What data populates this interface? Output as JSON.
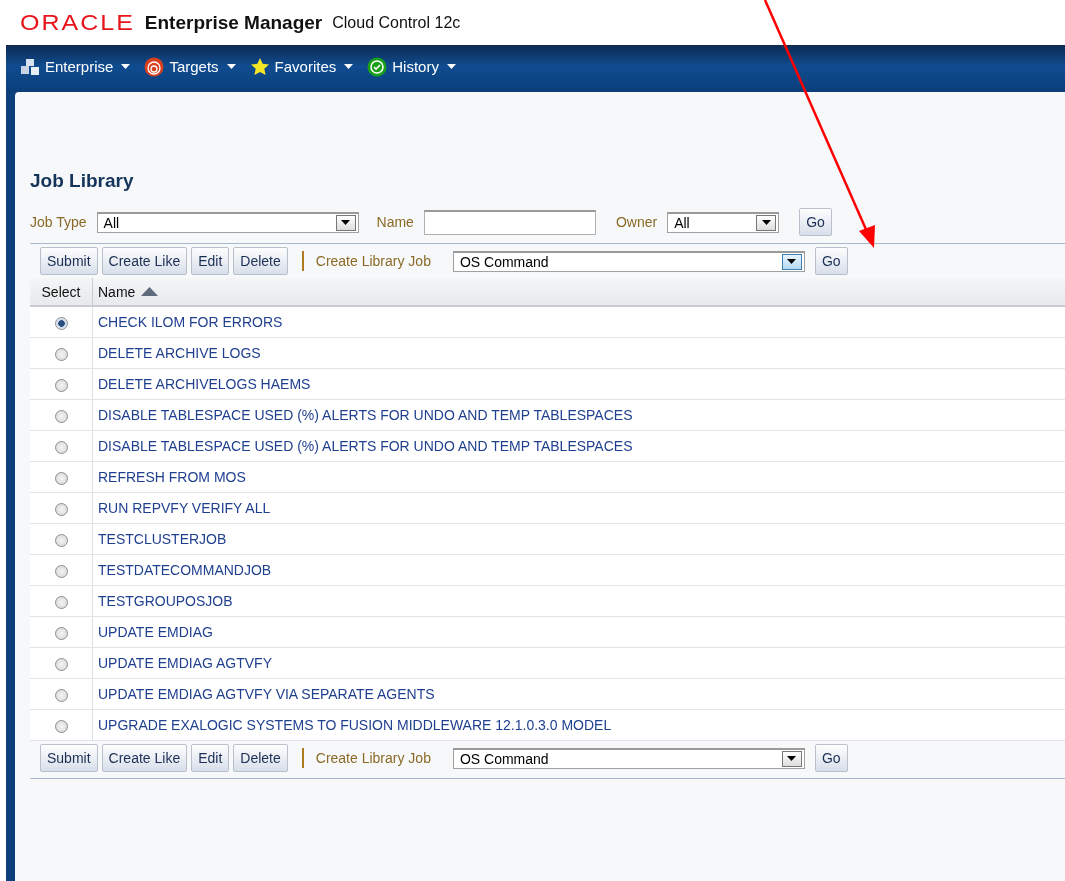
{
  "header": {
    "logo": "ORACLE",
    "product": "Enterprise Manager",
    "edition": "Cloud Control 12c"
  },
  "menu": [
    {
      "kind": "cubes",
      "label": "Enterprise"
    },
    {
      "kind": "target",
      "label": "Targets"
    },
    {
      "kind": "star",
      "label": "Favorites"
    },
    {
      "kind": "check",
      "label": "History"
    }
  ],
  "page_title": "Job Library",
  "filters": {
    "job_type": {
      "label": "Job Type",
      "value": "All"
    },
    "name": {
      "label": "Name"
    },
    "owner": {
      "label": "Owner",
      "value": "All"
    },
    "go": "Go"
  },
  "toolbar_top": {
    "buttons": [
      "Submit",
      "Create Like",
      "Edit",
      "Delete"
    ],
    "create_label": "Create Library Job",
    "create_value": "OS Command",
    "go": "Go"
  },
  "table": {
    "columns": [
      "Select",
      "Name"
    ],
    "rows": [
      {
        "name": "CHECK ILOM FOR ERRORS",
        "selected": true
      },
      {
        "name": "DELETE ARCHIVE LOGS",
        "selected": false
      },
      {
        "name": "DELETE ARCHIVELOGS HAEMS",
        "selected": false
      },
      {
        "name": "DISABLE TABLESPACE USED (%) ALERTS FOR UNDO AND TEMP TABLESPACES",
        "selected": false
      },
      {
        "name": "DISABLE TABLESPACE USED (%) ALERTS FOR UNDO AND TEMP TABLESPACES",
        "selected": false
      },
      {
        "name": "REFRESH FROM MOS",
        "selected": false
      },
      {
        "name": "RUN REPVFY VERIFY ALL",
        "selected": false
      },
      {
        "name": "TESTCLUSTERJOB",
        "selected": false
      },
      {
        "name": "TESTDATECOMMANDJOB",
        "selected": false
      },
      {
        "name": "TESTGROUPOSJOB",
        "selected": false
      },
      {
        "name": "UPDATE EMDIAG",
        "selected": false
      },
      {
        "name": "UPDATE EMDIAG AGTVFY",
        "selected": false
      },
      {
        "name": "UPDATE EMDIAG AGTVFY VIA SEPARATE AGENTS",
        "selected": false
      },
      {
        "name": "UPGRADE EXALOGIC SYSTEMS TO FUSION MIDDLEWARE 12.1.0.3.0 MODEL",
        "selected": false
      }
    ]
  },
  "toolbar_bottom": {
    "buttons": [
      "Submit",
      "Create Like",
      "Edit",
      "Delete"
    ],
    "create_label": "Create Library Job",
    "create_value": "OS Command",
    "go": "Go"
  }
}
